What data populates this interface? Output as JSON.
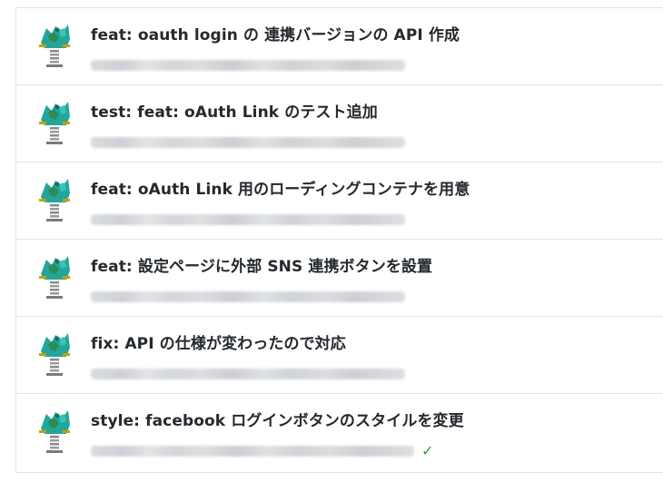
{
  "commits": [
    {
      "title": "feat: oauth login の 連携バージョンの API 作成",
      "status": ""
    },
    {
      "title": "test: feat: oAuth Link のテスト追加",
      "status": ""
    },
    {
      "title": "feat: oAuth Link 用のローディングコンテナを用意",
      "status": ""
    },
    {
      "title": "feat: 設定ページに外部 SNS 連携ボタンを設置",
      "status": ""
    },
    {
      "title": "fix: API の仕様が変わったので対応",
      "status": ""
    },
    {
      "title": "style: facebook ログインボタンのスタイルを変更",
      "status": "✓"
    }
  ],
  "icons": {
    "avatar": "spring-rider-avatar-icon",
    "check": "check-icon"
  },
  "colors": {
    "title": "#24292e",
    "border": "#e1e4e8",
    "success": "#28a745"
  }
}
